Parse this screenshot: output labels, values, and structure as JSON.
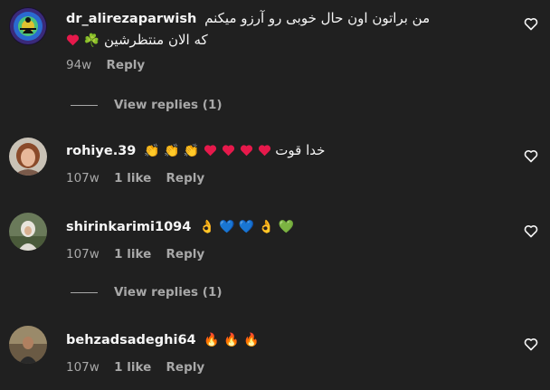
{
  "comments": [
    {
      "username": "dr_alirezaparwish",
      "text_line1": "من براتون اون حال خوبی رو آرزو میکنم",
      "text_line2": "که الان منتظرشین",
      "text_line2_emoji": "☘️",
      "time": "94w",
      "likes": "",
      "reply": "Reply",
      "view_replies": "View replies (1)"
    },
    {
      "username": "rohiye.39",
      "emojis": "👏 👏 👏",
      "text_line1": "خدا قوت",
      "time": "107w",
      "likes": "1 like",
      "reply": "Reply",
      "view_replies": ""
    },
    {
      "username": "shirinkarimi1094",
      "emojis": "👌 💙 💙 👌 💚",
      "time": "107w",
      "likes": "1 like",
      "reply": "Reply",
      "view_replies": "View replies (1)"
    },
    {
      "username": "behzadsadeghi64",
      "emojis": "🔥 🔥 🔥",
      "time": "107w",
      "likes": "1 like",
      "reply": "Reply",
      "view_replies": ""
    }
  ],
  "colors": {
    "background": "#202020",
    "text": "#f5f5f5",
    "secondary": "#a8a8a8",
    "heart_red": "#e6194b"
  },
  "icons": {
    "like": "heart-outline-icon",
    "inline_heart": "red-heart-icon"
  }
}
